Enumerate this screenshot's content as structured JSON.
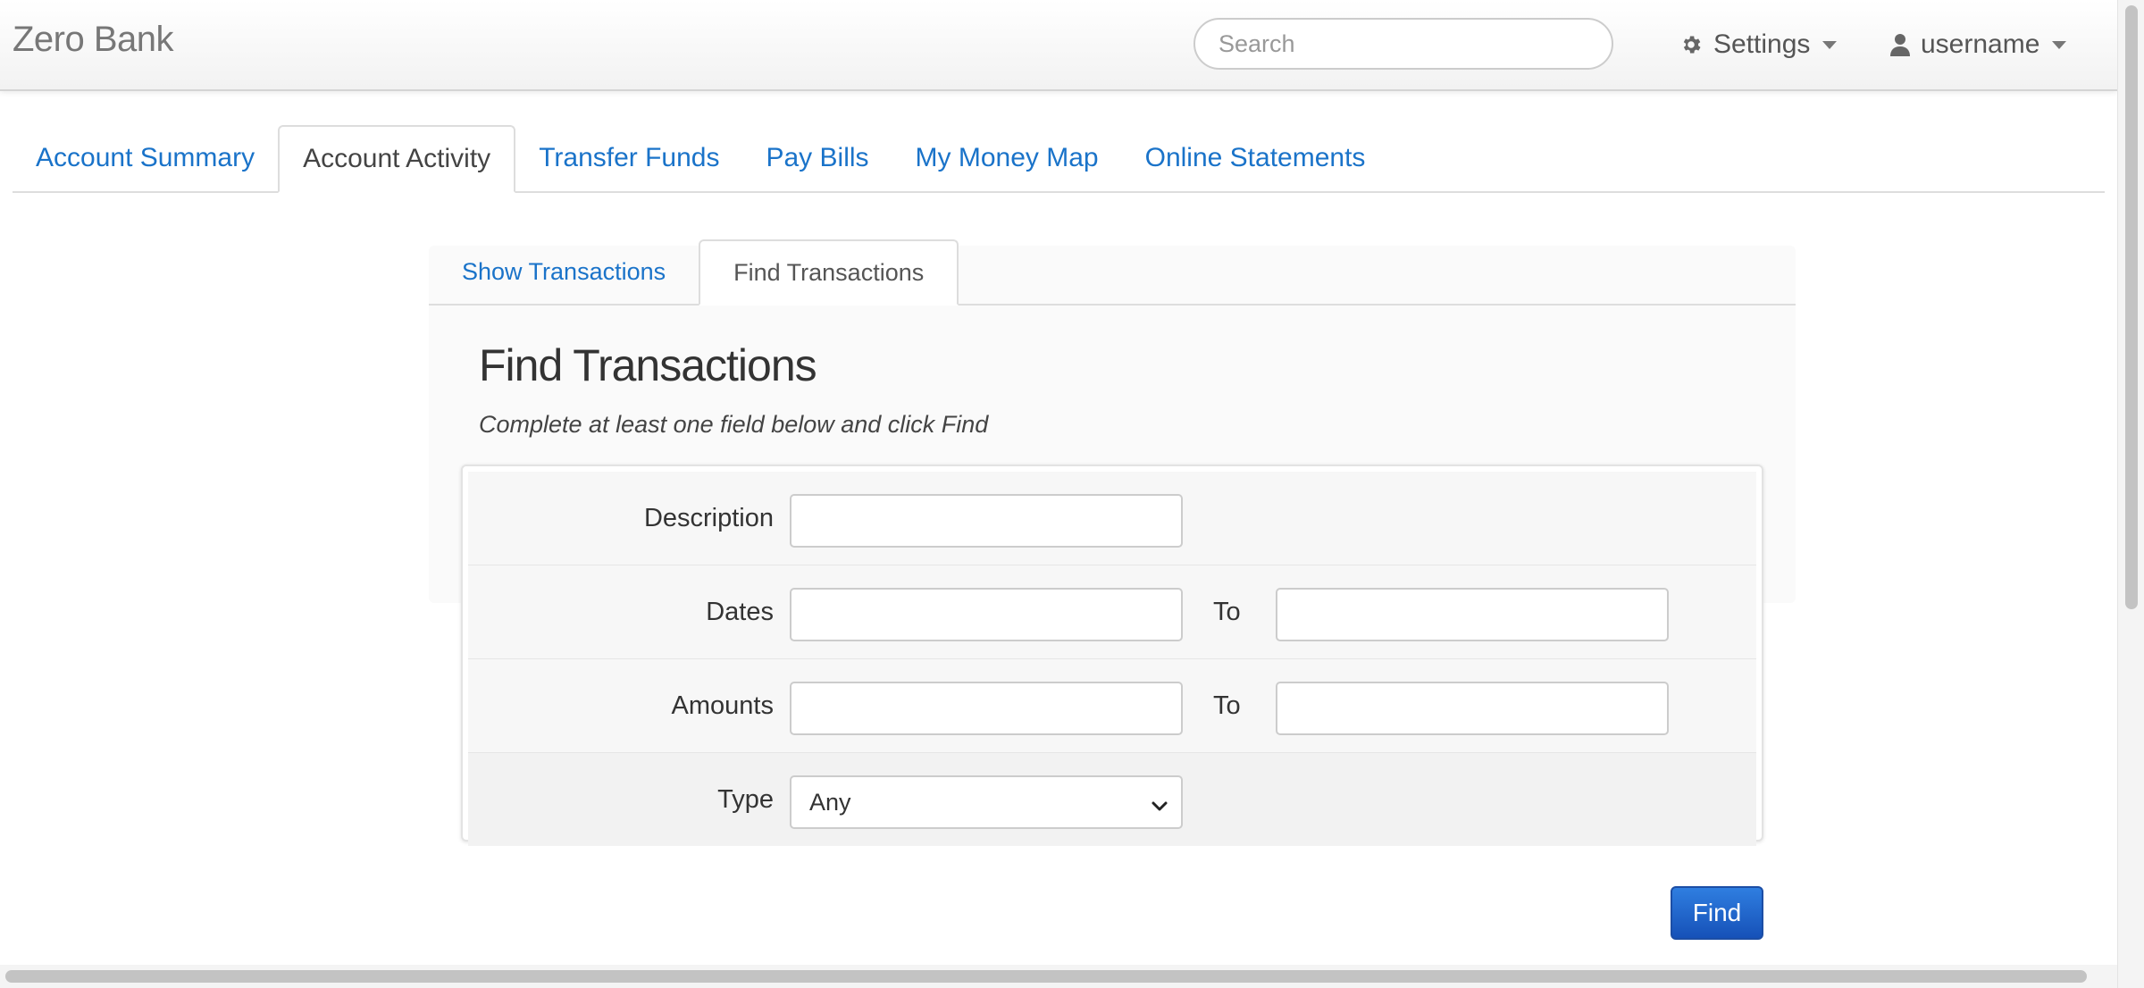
{
  "navbar": {
    "brand": "Zero Bank",
    "search_placeholder": "Search",
    "settings_label": "Settings",
    "user_label": "username",
    "settings_icon": "gear-icon",
    "user_icon": "user-icon"
  },
  "main_tabs": [
    {
      "label": "Account Summary",
      "active": false
    },
    {
      "label": "Account Activity",
      "active": true
    },
    {
      "label": "Transfer Funds",
      "active": false
    },
    {
      "label": "Pay Bills",
      "active": false
    },
    {
      "label": "My Money Map",
      "active": false
    },
    {
      "label": "Online Statements",
      "active": false
    }
  ],
  "sub_tabs": [
    {
      "label": "Show Transactions",
      "active": false
    },
    {
      "label": "Find Transactions",
      "active": true
    }
  ],
  "find": {
    "title": "Find Transactions",
    "instructions": "Complete at least one field below and click Find",
    "description_label": "Description",
    "description_value": "",
    "dates_label": "Dates",
    "dates_from_value": "",
    "dates_to_label": "To",
    "dates_to_value": "",
    "amounts_label": "Amounts",
    "amounts_from_value": "",
    "amounts_to_label": "To",
    "amounts_to_value": "",
    "type_label": "Type",
    "type_selected": "Any",
    "button_label": "Find"
  },
  "colors": {
    "link": "#1a73c9",
    "primary_button": "#1651b8"
  }
}
